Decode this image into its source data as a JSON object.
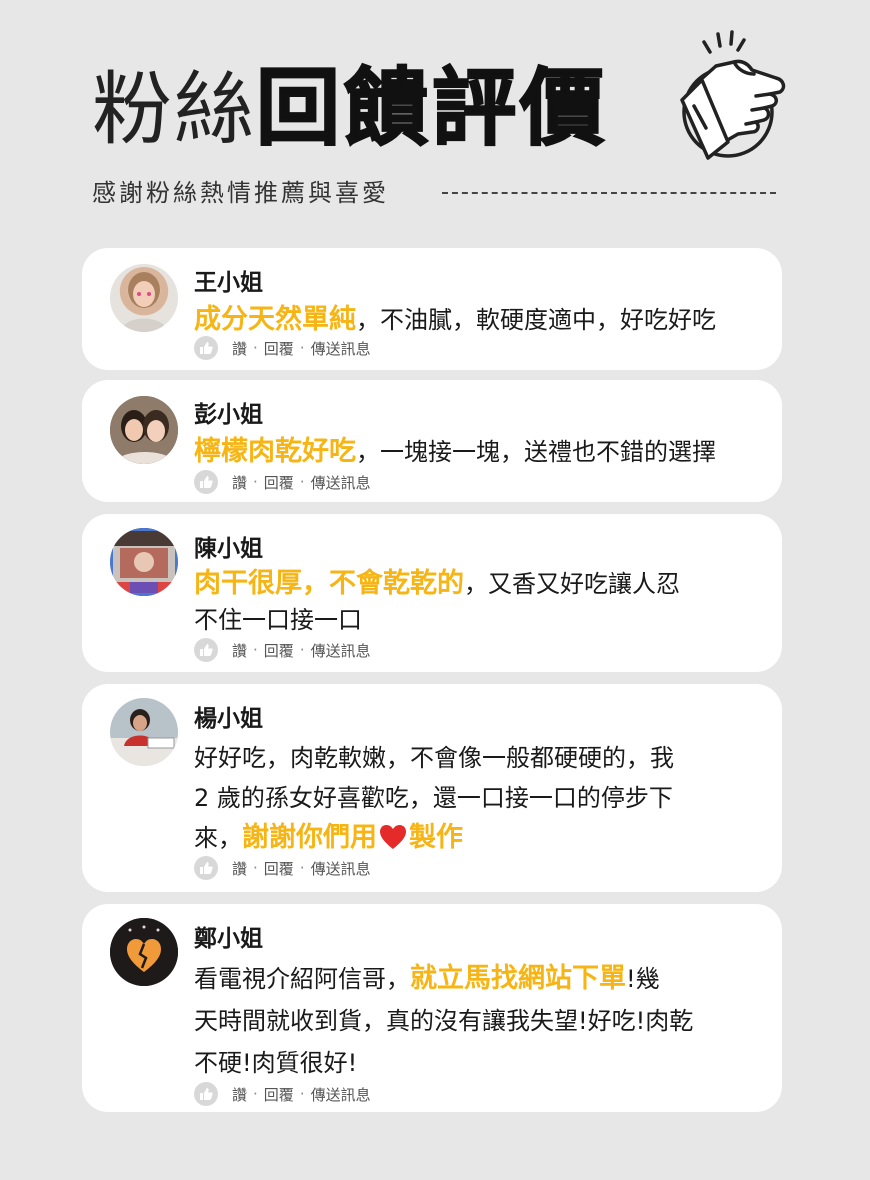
{
  "header": {
    "title_light": "粉絲",
    "title_bold": "回饋評價",
    "subtitle": "感謝粉絲熱情推薦與喜愛"
  },
  "actions": {
    "like": "讚",
    "reply": "回覆",
    "message": "傳送訊息",
    "separator": "·"
  },
  "colors": {
    "highlight": "#f7b515",
    "card": "#ffffff",
    "background": "#e8e7e8"
  },
  "reviews": [
    {
      "name": "王小姐",
      "lines": [
        [
          {
            "t": "成分天然單純",
            "h": true
          },
          {
            "t": "，不油膩，軟硬度適中，好吃好吃",
            "h": false
          }
        ]
      ]
    },
    {
      "name": "彭小姐",
      "lines": [
        [
          {
            "t": "檸檬肉乾好吃",
            "h": true
          },
          {
            "t": "，一塊接一塊，送禮也不錯的選擇",
            "h": false
          }
        ]
      ]
    },
    {
      "name": "陳小姐",
      "lines": [
        [
          {
            "t": "肉干很厚，不會乾乾的",
            "h": true
          },
          {
            "t": "，又香又好吃讓人忍",
            "h": false
          }
        ],
        [
          {
            "t": "不住一口接一口",
            "h": false
          }
        ]
      ]
    },
    {
      "name": "楊小姐",
      "lines": [
        [
          {
            "t": "好好吃，肉乾軟嫩，不會像一般都硬硬的，我",
            "h": false
          }
        ],
        [
          {
            "t": "2 歲的孫女好喜歡吃，還一口接一口的停步下",
            "h": false
          }
        ],
        [
          {
            "t": "來，",
            "h": false
          },
          {
            "t": "謝謝你們用",
            "h": true
          },
          {
            "heart": true
          },
          {
            "t": "製作",
            "h": true
          }
        ]
      ]
    },
    {
      "name": "鄭小姐",
      "lines": [
        [
          {
            "t": "看電視介紹阿信哥，",
            "h": false
          },
          {
            "t": "就立馬找網站下單",
            "h": true
          },
          {
            "t": "!幾",
            "h": false
          }
        ],
        [
          {
            "t": "天時間就收到貨，真的沒有讓我失望!好吃!肉乾",
            "h": false
          }
        ],
        [
          {
            "t": "不硬!肉質很好!",
            "h": false
          }
        ]
      ]
    }
  ]
}
